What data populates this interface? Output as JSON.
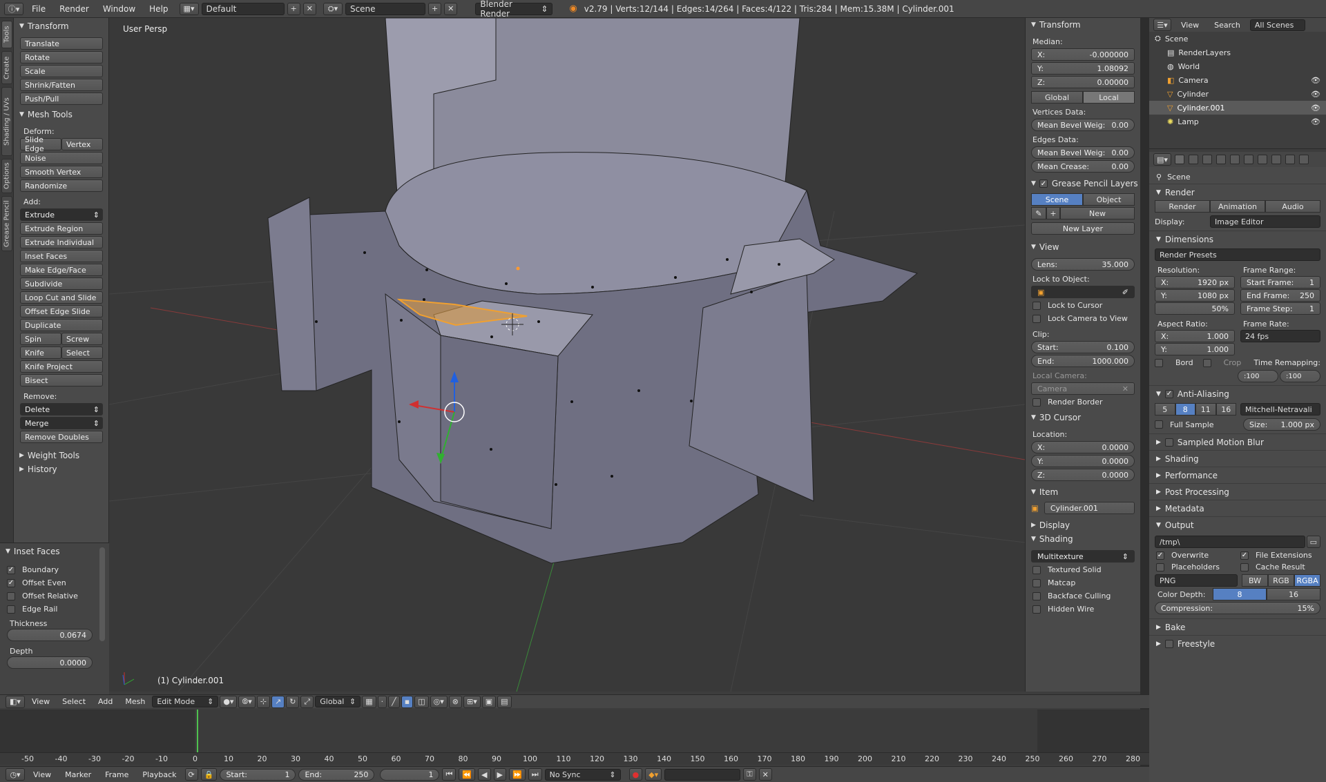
{
  "header": {
    "menus": [
      "File",
      "Render",
      "Window",
      "Help"
    ],
    "layout": "Default",
    "scene": "Scene",
    "engine": "Blender Render",
    "stats": "v2.79 | Verts:12/144 | Edges:14/264 | Faces:4/122 | Tris:284 | Mem:15.38M | Cylinder.001"
  },
  "toolshelf": {
    "tabs": [
      "Tools",
      "Create",
      "Shading / UVs",
      "Options",
      "Grease Pencil"
    ],
    "transform_title": "Transform",
    "transform": [
      "Translate",
      "Rotate",
      "Scale",
      "Shrink/Fatten",
      "Push/Pull"
    ],
    "mesh_tools_title": "Mesh Tools",
    "deform_label": "Deform:",
    "slide_edge": "Slide Edge",
    "vertex": "Vertex",
    "noise": "Noise",
    "smooth_vertex": "Smooth Vertex",
    "randomize": "Randomize",
    "add_label": "Add:",
    "extrude": "Extrude",
    "add_items": [
      "Extrude Region",
      "Extrude Individual",
      "Inset Faces",
      "Make Edge/Face",
      "Subdivide",
      "Loop Cut and Slide",
      "Offset Edge Slide",
      "Duplicate"
    ],
    "spin": "Spin",
    "screw": "Screw",
    "knife": "Knife",
    "select": "Select",
    "knife_project": "Knife Project",
    "bisect": "Bisect",
    "remove_label": "Remove:",
    "delete": "Delete",
    "merge": "Merge",
    "remove_doubles": "Remove Doubles",
    "weight_tools": "Weight Tools",
    "history": "History"
  },
  "operator": {
    "title": "Inset Faces",
    "boundary": "Boundary",
    "offset_even": "Offset Even",
    "offset_relative": "Offset Relative",
    "edge_rail": "Edge Rail",
    "thickness_label": "Thickness",
    "thickness": "0.0674",
    "depth_label": "Depth",
    "depth": "0.0000"
  },
  "viewport": {
    "view_name": "User Persp",
    "object_name": "(1) Cylinder.001"
  },
  "npanel": {
    "transform_title": "Transform",
    "median": "Median:",
    "x_label": "X:",
    "x": "-0.000000",
    "y_label": "Y:",
    "y": "1.08092",
    "z_label": "Z:",
    "z": "0.00000",
    "global": "Global",
    "local": "Local",
    "vertices_data": "Vertices Data:",
    "mean_bevel_weight": "Mean Bevel Weig:",
    "mbw_v": "0.00",
    "edges_data": "Edges Data:",
    "mbw_e": "0.00",
    "mean_crease": "Mean Crease:",
    "mc": "0.00",
    "gp_title": "Grease Pencil Layers",
    "scene_btn": "Scene",
    "object_btn": "Object",
    "new": "New",
    "new_layer": "New Layer",
    "view_title": "View",
    "lens_label": "Lens:",
    "lens": "35.000",
    "lock_to_object": "Lock to Object:",
    "lock_to_cursor": "Lock to Cursor",
    "lock_camera": "Lock Camera to View",
    "clip": "Clip:",
    "start_label": "Start:",
    "start": "0.100",
    "end_label": "End:",
    "end": "1000.000",
    "local_camera": "Local Camera:",
    "camera": "Camera",
    "render_border": "Render Border",
    "cursor_title": "3D Cursor",
    "location": "Location:",
    "cx": "0.0000",
    "cy": "0.0000",
    "cz": "0.0000",
    "item_title": "Item",
    "item_name": "Cylinder.001",
    "display_title": "Display",
    "shading_title": "Shading",
    "multitexture": "Multitexture",
    "textured_solid": "Textured Solid",
    "matcap": "Matcap",
    "backface": "Backface Culling",
    "hidden_wire": "Hidden Wire"
  },
  "outliner": {
    "view": "View",
    "search": "Search",
    "all_scenes": "All Scenes",
    "items": [
      "Scene",
      "RenderLayers",
      "World",
      "Camera",
      "Cylinder",
      "Cylinder.001",
      "Lamp"
    ]
  },
  "properties": {
    "context": "Scene",
    "render_title": "Render",
    "render": "Render",
    "animation": "Animation",
    "audio": "Audio",
    "display_label": "Display:",
    "display": "Image Editor",
    "dimensions_title": "Dimensions",
    "render_presets": "Render Presets",
    "resolution": "Resolution:",
    "rx_label": "X:",
    "rx": "1920 px",
    "ry_label": "Y:",
    "ry": "1080 px",
    "pct": "50%",
    "frame_range": "Frame Range:",
    "start_frame_label": "Start Frame:",
    "start_frame": "1",
    "end_frame_label": "End Frame:",
    "end_frame": "250",
    "frame_step_label": "Frame Step:",
    "frame_step": "1",
    "aspect": "Aspect Ratio:",
    "ax": "1.000",
    "ay": "1.000",
    "frame_rate": "Frame Rate:",
    "fps": "24 fps",
    "bord": "Bord",
    "crop": "Crop",
    "time_remap": "Time Remapping:",
    "old": ":100",
    "new": ":100",
    "aa_title": "Anti-Aliasing",
    "aa_samples": [
      "5",
      "8",
      "11",
      "16"
    ],
    "filter": "Mitchell-Netravali",
    "full_sample": "Full Sample",
    "size_label": "Size:",
    "size": "1.000 px",
    "sections": [
      "Sampled Motion Blur",
      "Shading",
      "Performance",
      "Post Processing",
      "Metadata"
    ],
    "output_title": "Output",
    "path": "/tmp\\",
    "overwrite": "Overwrite",
    "file_ext": "File Extensions",
    "placeholders": "Placeholders",
    "cache": "Cache Result",
    "format": "PNG",
    "bw": "BW",
    "rgb": "RGB",
    "rgba": "RGBA",
    "color_depth": "Color Depth:",
    "d8": "8",
    "d16": "16",
    "compression_label": "Compression:",
    "compression": "15%",
    "bake": "Bake",
    "freestyle": "Freestyle"
  },
  "vphead": {
    "menus": [
      "View",
      "Select",
      "Add",
      "Mesh"
    ],
    "mode": "Edit Mode",
    "orientation": "Global"
  },
  "timeline": {
    "ticks": [
      "-50",
      "-40",
      "-30",
      "-20",
      "-10",
      "0",
      "10",
      "20",
      "30",
      "40",
      "50",
      "60",
      "70",
      "80",
      "90",
      "100",
      "110",
      "120",
      "130",
      "140",
      "150",
      "160",
      "170",
      "180",
      "190",
      "200",
      "210",
      "220",
      "230",
      "240",
      "250",
      "260",
      "270",
      "280"
    ],
    "menus": [
      "View",
      "Marker",
      "Frame",
      "Playback"
    ],
    "start_label": "Start:",
    "start": "1",
    "end_label": "End:",
    "end": "250",
    "current": "1",
    "sync": "No Sync"
  }
}
